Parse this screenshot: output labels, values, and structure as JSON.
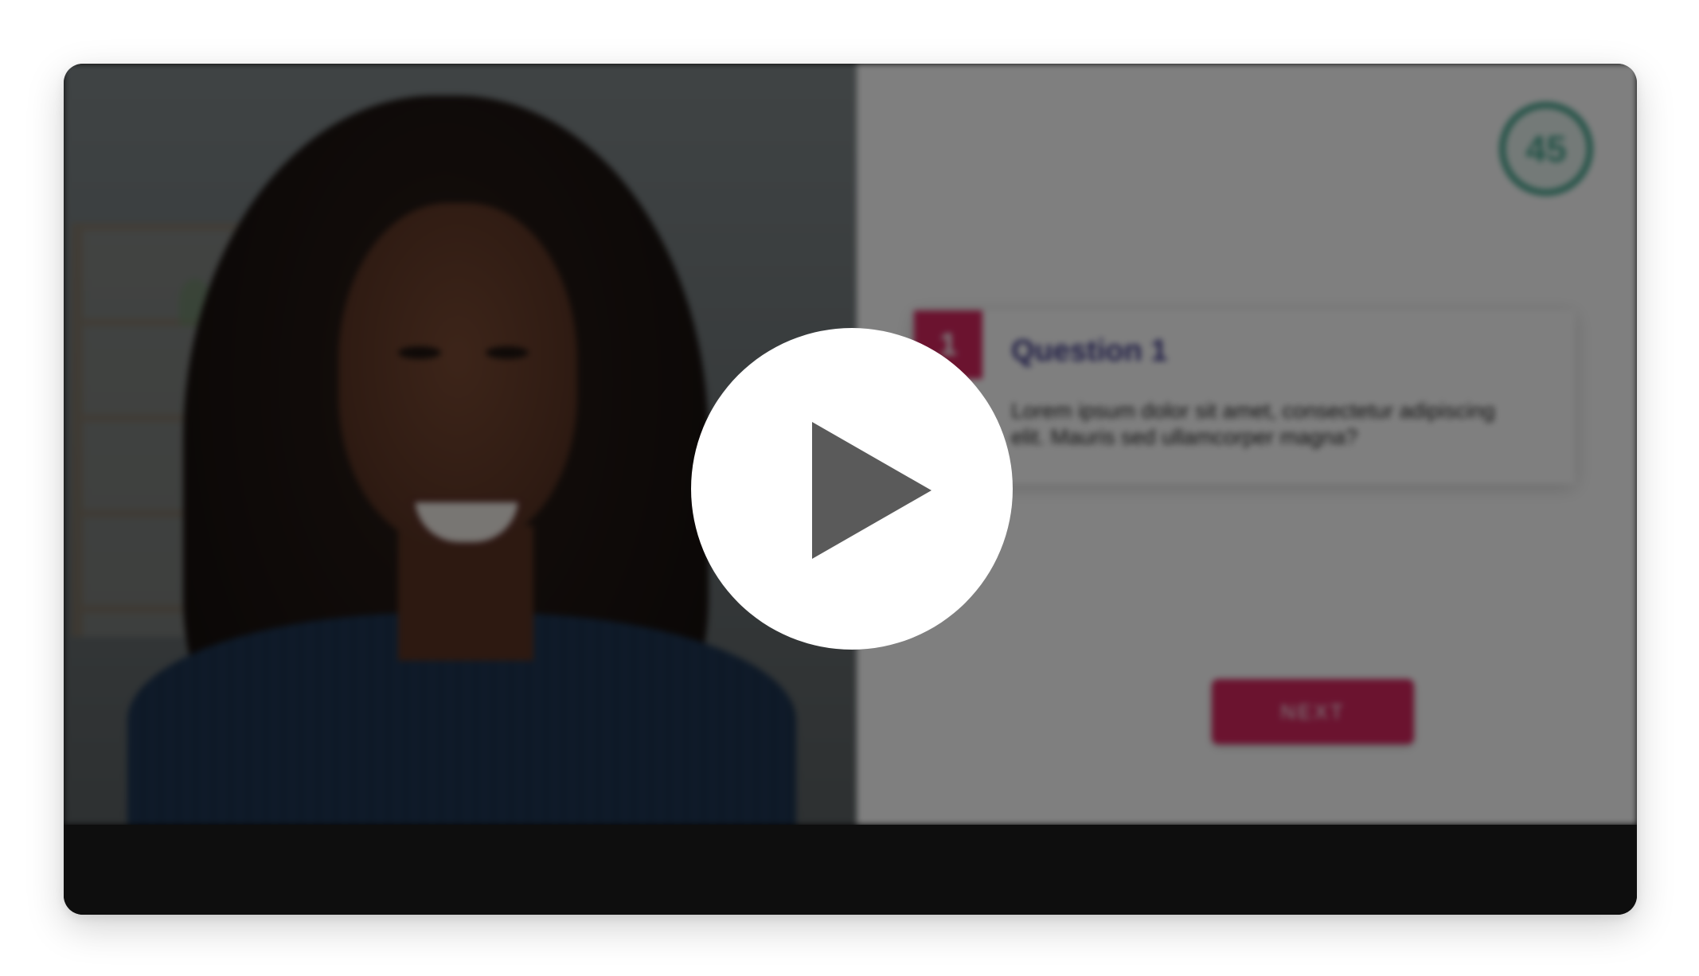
{
  "player": {
    "timer": {
      "value": "45"
    },
    "question": {
      "number": "1",
      "title": "Question 1",
      "text": "Lorem ipsum dolor sit amet, consectetur adipiscing elit. Mauris sed ullamcorper magna?"
    },
    "next_button": {
      "label": "NEXT"
    },
    "play_button": {
      "icon": "play-icon"
    }
  },
  "colors": {
    "accent": "#d6265f",
    "timer": "#46a58e",
    "question_title": "#3e3a8a",
    "control_bar": "#0e0e0e"
  }
}
